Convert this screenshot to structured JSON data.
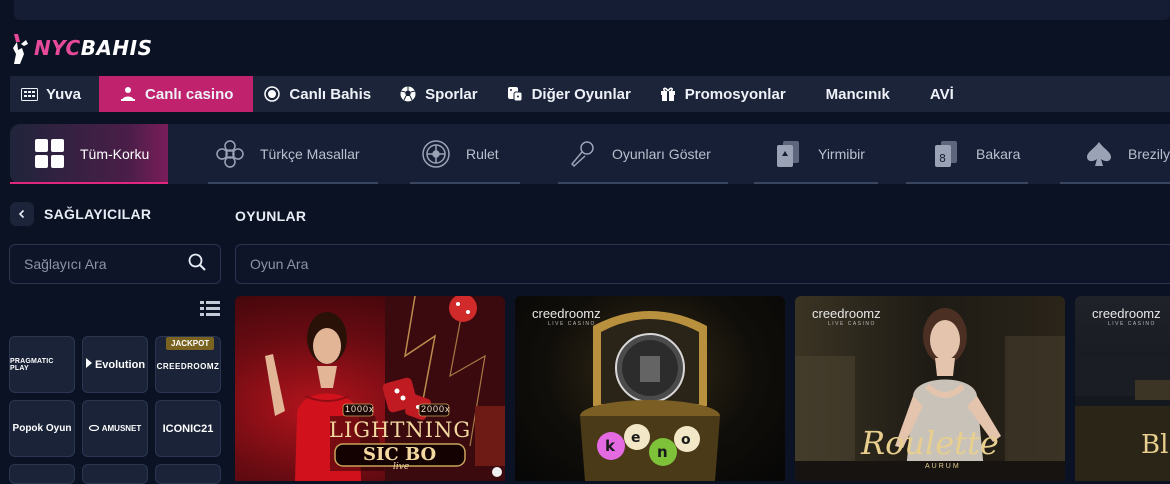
{
  "brand": {
    "name_a": "NYC",
    "name_b": "BAHIS",
    "accent": "#e84a9b"
  },
  "nav": [
    {
      "label": "Yuva",
      "icon": "grid-icon"
    },
    {
      "label": "Canlı casino",
      "icon": "dealer-icon",
      "active": true
    },
    {
      "label": "Canlı Bahis",
      "icon": "live-dot-icon"
    },
    {
      "label": "Sporlar",
      "icon": "soccer-ball-icon"
    },
    {
      "label": "Diğer Oyunlar",
      "icon": "dice-icon"
    },
    {
      "label": "Promosyonlar",
      "icon": "gift-icon"
    },
    {
      "label": "Mancınık",
      "icon": ""
    },
    {
      "label": "AVİ",
      "icon": ""
    }
  ],
  "categories": [
    {
      "label": "Tüm-Korku",
      "icon": "tiles-icon",
      "active": true
    },
    {
      "label": "Türkçe Masallar",
      "icon": "mandala-icon"
    },
    {
      "label": "Rulet",
      "icon": "roulette-icon"
    },
    {
      "label": "Oyunları Göster",
      "icon": "microphone-icon"
    },
    {
      "label": "Yirmibir",
      "icon": "cards-icon"
    },
    {
      "label": "Bakara",
      "icon": "card-eight-icon"
    },
    {
      "label": "Brezilya",
      "icon": "spade-icon"
    }
  ],
  "sidebar": {
    "title": "SAĞLAYICILAR",
    "search_placeholder": "Sağlayıcı Ara",
    "providers": [
      {
        "label": "PRAGMATIC PLAY"
      },
      {
        "label": "Evolution"
      },
      {
        "label": "CREEDROOMZ",
        "badge": "JACKPOT"
      },
      {
        "label": "Popok Oyun"
      },
      {
        "label": "AMUSNET"
      },
      {
        "label": "ICONIC21"
      }
    ]
  },
  "games": {
    "title": "OYUNLAR",
    "search_placeholder": "Oyun Ara",
    "cards": [
      {
        "title": "LIGHTNING",
        "subtitle": "SIC BO",
        "tag": "live",
        "multipliers": [
          "1000x",
          "2000x"
        ]
      },
      {
        "provider": "creedroomz",
        "provider_sub": "LIVE CASINO",
        "title": "keno"
      },
      {
        "provider": "creedroomz",
        "provider_sub": "LIVE CASINO",
        "title": "Roulette",
        "subtitle": "AURUM"
      },
      {
        "provider": "creedroomz",
        "provider_sub": "LIVE CASINO",
        "title": "Bl"
      }
    ]
  }
}
